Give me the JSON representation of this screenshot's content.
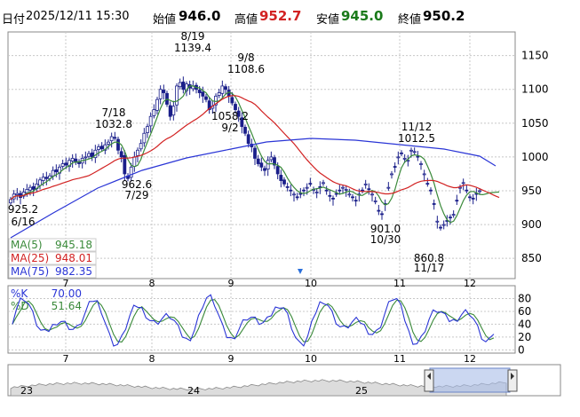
{
  "header": {
    "date_label": "日付",
    "datetime": "2025/12/11 15:30",
    "open_label": "始値",
    "open_value": "946.0",
    "high_label": "高値",
    "high_value": "952.7",
    "low_label": "安値",
    "low_value": "945.0",
    "close_label": "終値",
    "close_value": "950.2"
  },
  "colors": {
    "up": "#1a1f8a",
    "down": "#1a1f8a",
    "up_fill": "#ffffff",
    "ma5": "#3a8a3a",
    "ma25": "#d22222",
    "ma75": "#2a35d6",
    "k": "#2a35d6",
    "d": "#3a8a3a",
    "high_text": "#d22222",
    "low_text": "#1a7a1a",
    "grid": "#c8c8c8",
    "nav_fill": "#a8bde8"
  },
  "legend": [
    {
      "label": "MA(5)",
      "value": "945.18",
      "color": "#3a8a3a"
    },
    {
      "label": "MA(25)",
      "value": "948.01",
      "color": "#d22222"
    },
    {
      "label": "MA(75)",
      "value": "982.35",
      "color": "#2a35d6"
    }
  ],
  "stoch_legend": [
    {
      "label": "%K",
      "value": "70.00",
      "color": "#2a35d6"
    },
    {
      "label": "%D",
      "value": "51.64",
      "color": "#3a8a3a"
    }
  ],
  "navigator_labels": [
    "23",
    "24",
    "25"
  ],
  "chart_data": {
    "type": "candlestick",
    "price_axis": {
      "ticks": [
        850,
        900,
        950,
        1000,
        1050,
        1100,
        1150
      ],
      "range": [
        820,
        1185
      ]
    },
    "stoch_axis": {
      "ticks": [
        0,
        20,
        40,
        60,
        80
      ],
      "range": [
        -5,
        100
      ]
    },
    "month_labels": [
      "7",
      "8",
      "9",
      "10",
      "11",
      "12"
    ],
    "annotations": [
      {
        "date": "6/16",
        "value": "925.2"
      },
      {
        "date": "7/18",
        "value": "1032.8"
      },
      {
        "date": "7/29",
        "value": "962.6"
      },
      {
        "date": "8/19",
        "value": "1139.4"
      },
      {
        "date": "9/8",
        "value": "1108.6"
      },
      {
        "date": "9/2",
        "value": "1058.2"
      },
      {
        "date": "11/12",
        "value": "1012.5"
      },
      {
        "date": "10/30",
        "value": "901.0"
      },
      {
        "date": "11/17",
        "value": "860.8"
      }
    ],
    "closes": [
      937,
      945,
      946,
      940,
      948,
      952,
      955,
      952,
      960,
      966,
      970,
      968,
      972,
      980,
      978,
      985,
      990,
      988,
      995,
      998,
      992,
      990,
      998,
      1000,
      1005,
      1000,
      1010,
      1015,
      1012,
      1018,
      1022,
      1030,
      1028,
      1010,
      1000,
      975,
      968,
      985,
      1000,
      1010,
      1020,
      1035,
      1045,
      1060,
      1070,
      1085,
      1100,
      1095,
      1078,
      1060,
      1075,
      1105,
      1110,
      1100,
      1108,
      1102,
      1105,
      1100,
      1095,
      1090,
      1085,
      1070,
      1075,
      1090,
      1095,
      1105,
      1100,
      1090,
      1080,
      1070,
      1060,
      1045,
      1035,
      1020,
      1015,
      998,
      990,
      985,
      980,
      995,
      1000,
      988,
      975,
      965,
      960,
      955,
      950,
      945,
      940,
      945,
      950,
      955,
      960,
      952,
      948,
      955,
      962,
      950,
      942,
      938,
      945,
      950,
      955,
      952,
      945,
      940,
      935,
      945,
      950,
      960,
      952,
      945,
      935,
      920,
      915,
      930,
      955,
      975,
      985,
      1000,
      1005,
      998,
      995,
      1010,
      1008,
      1000,
      990,
      975,
      960,
      950,
      930,
      905,
      895,
      900,
      905,
      910,
      915,
      935,
      955,
      962,
      950,
      940,
      938,
      945,
      950,
      948,
      946,
      945,
      948,
      952,
      950
    ],
    "opens": [
      932,
      938,
      944,
      946,
      942,
      947,
      951,
      956,
      953,
      958,
      965,
      970,
      968,
      972,
      981,
      976,
      986,
      991,
      986,
      994,
      997,
      993,
      991,
      999,
      1001,
      1006,
      999,
      1011,
      1016,
      1010,
      1019,
      1024,
      1029,
      1026,
      1008,
      1002,
      972,
      970,
      986,
      1002,
      1012,
      1021,
      1036,
      1046,
      1061,
      1069,
      1086,
      1099,
      1094,
      1076,
      1062,
      1077,
      1104,
      1111,
      1098,
      1107,
      1101,
      1106,
      1099,
      1096,
      1089,
      1083,
      1072,
      1077,
      1091,
      1094,
      1104,
      1099,
      1088,
      1078,
      1068,
      1058,
      1044,
      1033,
      1019,
      1013,
      997,
      991,
      983,
      982,
      996,
      999,
      986,
      973,
      966,
      956,
      951,
      944,
      941,
      946,
      951,
      954,
      961,
      951,
      947,
      956,
      961,
      951,
      943,
      939,
      946,
      951,
      954,
      951,
      944,
      941,
      936,
      944,
      951,
      959,
      953,
      944,
      934,
      921,
      916,
      931,
      954,
      974,
      986,
      999,
      1006,
      997,
      994,
      1009,
      1007,
      1001,
      989,
      974,
      961,
      951,
      931,
      904,
      896,
      899,
      906,
      911,
      914,
      936,
      954,
      961,
      951,
      941,
      939,
      946,
      949
    ]
  }
}
